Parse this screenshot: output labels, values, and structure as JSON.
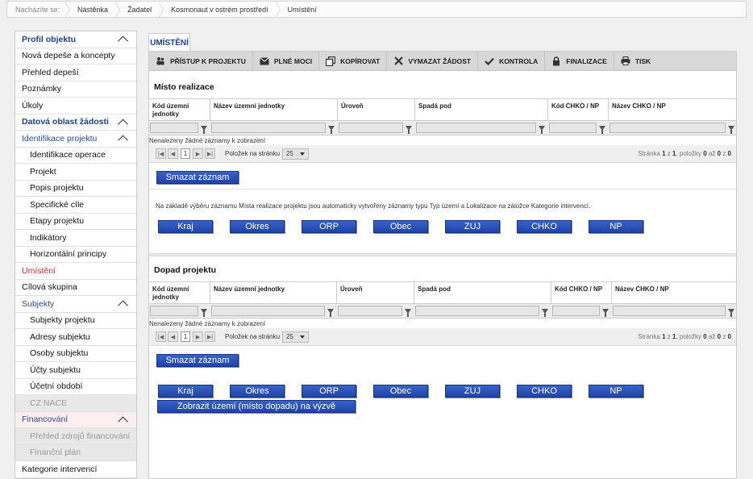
{
  "breadcrumb": {
    "lead": "Nacházíte se:",
    "items": [
      "Nástěnka",
      "Žadatel",
      "Kosmonaut v ostrém prostředí",
      "Umístění"
    ]
  },
  "sidebar": {
    "items": [
      {
        "label": "Profil objektu",
        "type": "section"
      },
      {
        "label": "Nová depeše a koncepty",
        "type": "plain"
      },
      {
        "label": "Přehled depeší",
        "type": "plain"
      },
      {
        "label": "Poznámky",
        "type": "plain"
      },
      {
        "label": "Úkoly",
        "type": "plain"
      },
      {
        "label": "Datová oblast žádosti",
        "type": "section"
      },
      {
        "label": "Identifikace projektu",
        "type": "sub"
      },
      {
        "label": "Identifikace operace",
        "type": "indent"
      },
      {
        "label": "Projekt",
        "type": "indent"
      },
      {
        "label": "Popis projektu",
        "type": "indent"
      },
      {
        "label": "Specifické cíle",
        "type": "indent"
      },
      {
        "label": "Etapy projektu",
        "type": "indent"
      },
      {
        "label": "Indikátory",
        "type": "indent"
      },
      {
        "label": "Horizontální principy",
        "type": "indent"
      },
      {
        "label": "Umístění",
        "type": "active"
      },
      {
        "label": "Cílová skupina",
        "type": "plain"
      },
      {
        "label": "Subjekty",
        "type": "sub"
      },
      {
        "label": "Subjekty projektu",
        "type": "indent"
      },
      {
        "label": "Adresy subjektu",
        "type": "indent"
      },
      {
        "label": "Osoby subjektu",
        "type": "indent"
      },
      {
        "label": "Účty subjektu",
        "type": "indent"
      },
      {
        "label": "Účetní období",
        "type": "indent"
      },
      {
        "label": "CZ NACE",
        "type": "disabled"
      },
      {
        "label": "Financování",
        "type": "subpink"
      },
      {
        "label": "Přehled zdrojů financování",
        "type": "disabled"
      },
      {
        "label": "Finanční plán",
        "type": "disabled"
      },
      {
        "label": "Kategorie intervencí",
        "type": "plain"
      }
    ]
  },
  "tab": {
    "label": "UMÍSTĚNÍ"
  },
  "toolbar": {
    "buttons": [
      {
        "label": "PŘÍSTUP K PROJEKTU",
        "icon": "users-icon"
      },
      {
        "label": "PLNÉ MOCI",
        "icon": "envelope-icon"
      },
      {
        "label": "KOPÍROVAT",
        "icon": "copy-icon"
      },
      {
        "label": "VYMAZAT ŽÁDOST",
        "icon": "x-icon"
      },
      {
        "label": "KONTROLA",
        "icon": "check-icon"
      },
      {
        "label": "FINALIZACE",
        "icon": "lock-icon"
      },
      {
        "label": "TISK",
        "icon": "printer-icon"
      }
    ]
  },
  "grid_columns": [
    "Kód územní jednotky",
    "Název územní jednotky",
    "Úroveň",
    "Spadá pod",
    "Kód CHKO / NP",
    "Název CHKO / NP"
  ],
  "section1": {
    "title": "Místo realizace",
    "empty": "Nenalezeny žádné záznamy k zobrazení",
    "delete_label": "Smazat záznam",
    "note": "Na základě výběru záznamu Místa realizace projektu jsou automaticky vytvořeny záznamy typu Typ území a Lokalizace na záložce Kategorie intervencí."
  },
  "section2": {
    "title": "Dopad projektu",
    "empty": "Nenalezeny žádné záznamy k zobrazení",
    "delete_label": "Smazat záznam",
    "show_label": "Zobrazit území (místo dopadu) na výzvě"
  },
  "pager": {
    "page": "1",
    "per_page_label": "Položek na stránku",
    "per_page": "25",
    "info_prefix": "Stránka",
    "info_page": "1",
    "info_of": "z",
    "info_total_pages": "1",
    "info_items": ", položky",
    "info_from": "0",
    "info_to_label": "až",
    "info_to": "0",
    "info_of2": "z",
    "info_count": "0"
  },
  "level_buttons": [
    "Kraj",
    "Okres",
    "ORP",
    "Obec",
    "ZUJ",
    "CHKO",
    "NP"
  ],
  "colors": {
    "accent": "#1f44a8",
    "active": "#d32f2f",
    "section": "#1f3e8c"
  }
}
